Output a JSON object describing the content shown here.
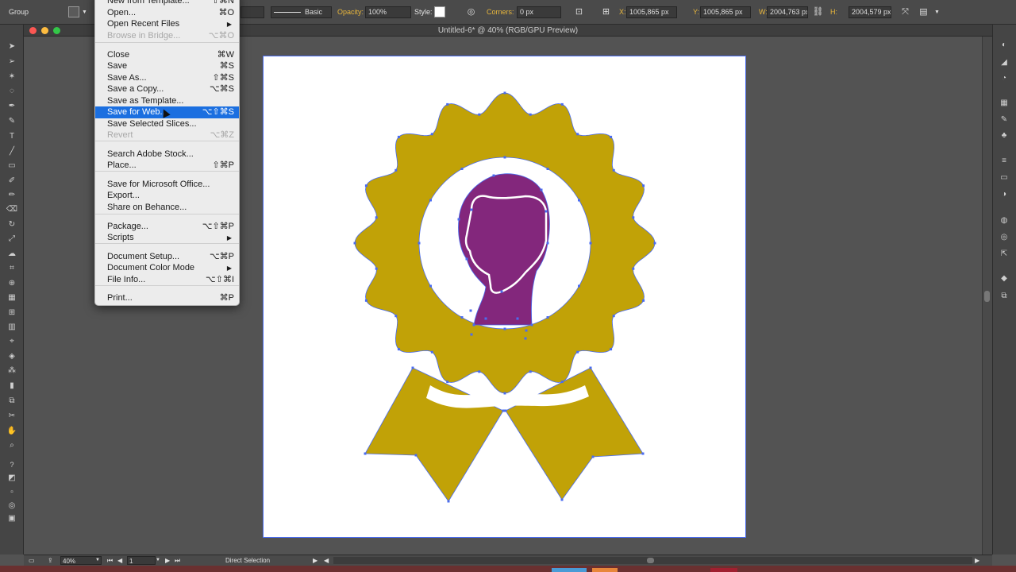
{
  "control_bar": {
    "selection_label": "Group",
    "stroke_profile": "Basic",
    "opacity_label": "Opacity:",
    "opacity_value": "100%",
    "style_label": "Style:",
    "corners_label": "Corners:",
    "corners_value": "0 px",
    "x_label": "X:",
    "x_value": "1005,865 px",
    "y_label": "Y:",
    "y_value": "1005,865 px",
    "w_label": "W:",
    "w_value": "2004,763 px",
    "h_label": "H:",
    "h_value": "2004,579 px"
  },
  "document": {
    "title": "Untitled-6* @ 40% (RGB/GPU Preview)"
  },
  "file_menu": {
    "items": [
      {
        "label": "New from Template...",
        "shortcut": "⇧⌘N"
      },
      {
        "label": "Open...",
        "shortcut": "⌘O"
      },
      {
        "label": "Open Recent Files",
        "shortcut": "▶"
      },
      {
        "label": "Browse in Bridge...",
        "shortcut": "⌥⌘O"
      },
      {
        "label": "Close",
        "shortcut": "⌘W"
      },
      {
        "label": "Save",
        "shortcut": "⌘S"
      },
      {
        "label": "Save As...",
        "shortcut": "⇧⌘S"
      },
      {
        "label": "Save a Copy...",
        "shortcut": "⌥⌘S"
      },
      {
        "label": "Save as Template...",
        "shortcut": ""
      },
      {
        "label": "Save for Web...",
        "shortcut": "⌥⇧⌘S"
      },
      {
        "label": "Save Selected Slices...",
        "shortcut": ""
      },
      {
        "label": "Revert",
        "shortcut": "⌥⌘Z"
      },
      {
        "label": "Search Adobe Stock...",
        "shortcut": ""
      },
      {
        "label": "Place...",
        "shortcut": "⇧⌘P"
      },
      {
        "label": "Save for Microsoft Office...",
        "shortcut": ""
      },
      {
        "label": "Export...",
        "shortcut": ""
      },
      {
        "label": "Share on Behance...",
        "shortcut": ""
      },
      {
        "label": "Package...",
        "shortcut": "⌥⇧⌘P"
      },
      {
        "label": "Scripts",
        "shortcut": "▶"
      },
      {
        "label": "Document Setup...",
        "shortcut": "⌥⌘P"
      },
      {
        "label": "Document Color Mode",
        "shortcut": "▶"
      },
      {
        "label": "File Info...",
        "shortcut": "⌥⇧⌘I"
      },
      {
        "label": "Print...",
        "shortcut": "⌘P"
      }
    ]
  },
  "status_bar": {
    "zoom": "40%",
    "artboard_number": "1",
    "tool_name": "Direct Selection"
  },
  "colors": {
    "badge_gold": "#c1a207",
    "silhouette_purple": "#83277c",
    "selection_blue": "#4a6cf0",
    "menu_highlight": "#1b6fe0"
  }
}
